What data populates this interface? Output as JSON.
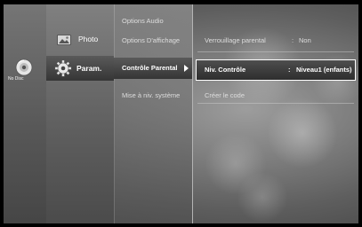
{
  "disc": {
    "label": "No Disc",
    "icon": "disc-icon"
  },
  "main_menu": [
    {
      "label": "Photo",
      "icon": "photo-icon"
    },
    {
      "label": "Param.",
      "icon": "gear-icon",
      "selected": true
    }
  ],
  "sub_menu": [
    {
      "label": "Options Audio"
    },
    {
      "label": "Options D'affichage"
    },
    {
      "label": "Contrôle Parental",
      "selected": true
    },
    {
      "label": "Mise à niv. système"
    }
  ],
  "detail": {
    "lock_label": "Verrouillage parental",
    "lock_separator": ":",
    "lock_value": "Non",
    "level_label": "Niv. Contrôle",
    "level_separator": ":",
    "level_value": "Niveau1 (enfants)",
    "create_code": "Créer le code"
  },
  "colors": {
    "highlight_border": "#ffffff",
    "text": "#ffffff"
  }
}
